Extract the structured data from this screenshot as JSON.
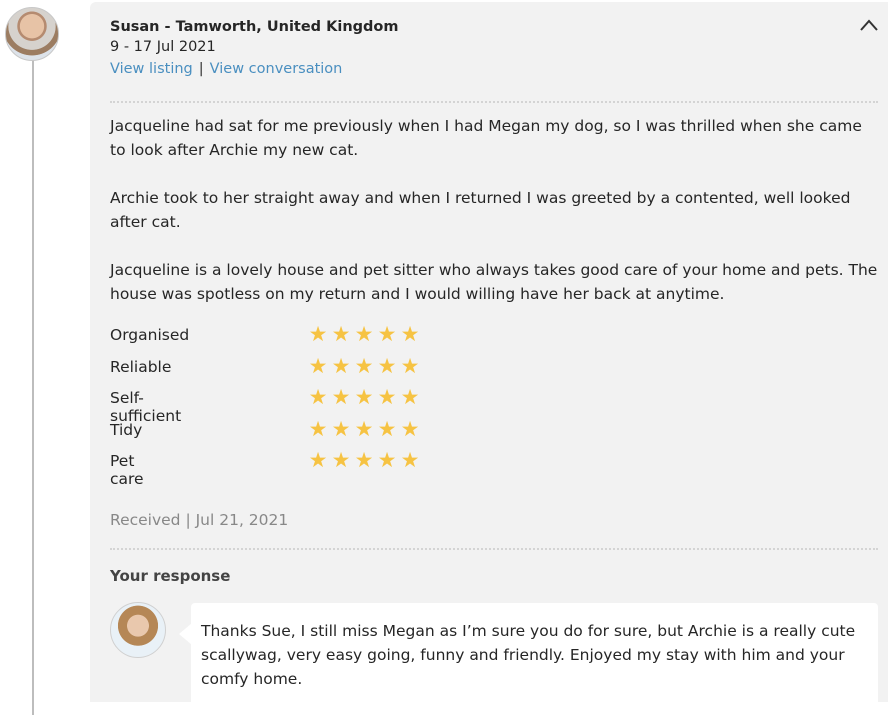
{
  "review": {
    "reviewer_name": "Susan - Tamworth, United Kingdom",
    "date_range": "9 - 17 Jul 2021",
    "links": {
      "view_listing": "View listing",
      "separator": "|",
      "view_conversation": "View conversation"
    },
    "paragraphs": [
      "Jacqueline had sat for me previously when I had Megan my dog, so I was thrilled when she came to look after Archie my new cat.",
      "Archie took to her straight away and when I returned I was greeted by a contented, well looked after cat.",
      "Jacqueline is a lovely house and pet sitter who always takes good care of your home and pets. The house was spotless on my return and I would willing have her back at anytime."
    ],
    "ratings": [
      {
        "label": "Organised",
        "stars": 5,
        "max": 5
      },
      {
        "label": "Reliable",
        "stars": 5,
        "max": 5
      },
      {
        "label": "Self-sufficient",
        "stars": 5,
        "max": 5
      },
      {
        "label": "Tidy",
        "stars": 5,
        "max": 5
      },
      {
        "label": "Pet care",
        "stars": 5,
        "max": 5
      }
    ],
    "star_glyph": "★",
    "star_color": "#f6c343",
    "received": "Received | Jul 21, 2021"
  },
  "response": {
    "title": "Your response",
    "text": "Thanks Sue, I still miss Megan as I’m sure you do for sure, but Archie is a really cute scallywag, very easy going, funny and friendly. Enjoyed my stay with him and your comfy home."
  },
  "colors": {
    "link": "#4a8fc0",
    "card_bg": "#f2f2f2",
    "muted_text": "#888888"
  },
  "icons": {
    "collapse": "chevron-up-icon"
  }
}
